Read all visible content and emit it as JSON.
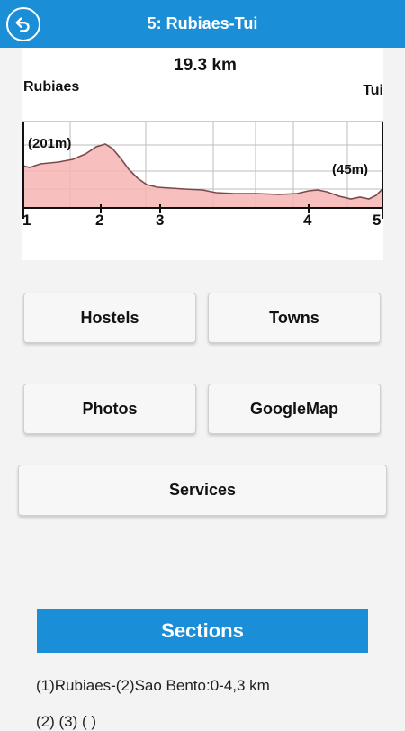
{
  "header": {
    "title": "5: Rubiaes-Tui",
    "back_icon": "back-arrow-icon",
    "color": "#1a8fd8"
  },
  "profile": {
    "distance": "19.3 km",
    "start_town": "Rubiaes",
    "end_town": "Tui",
    "start_elevation": "(201m)",
    "end_elevation": "(45m)",
    "markers": [
      "1",
      "2",
      "3",
      "4",
      "5"
    ]
  },
  "buttons": {
    "hostels": "Hostels",
    "towns": "Towns",
    "photos": "Photos",
    "googlemap": "GoogleMap",
    "services": "Services"
  },
  "sections": {
    "header": "Sections",
    "items": [
      "(1)Rubiaes-(2)Sao Bento:0-4,3 km",
      "(2)                    (3)                                    (     )"
    ]
  }
}
